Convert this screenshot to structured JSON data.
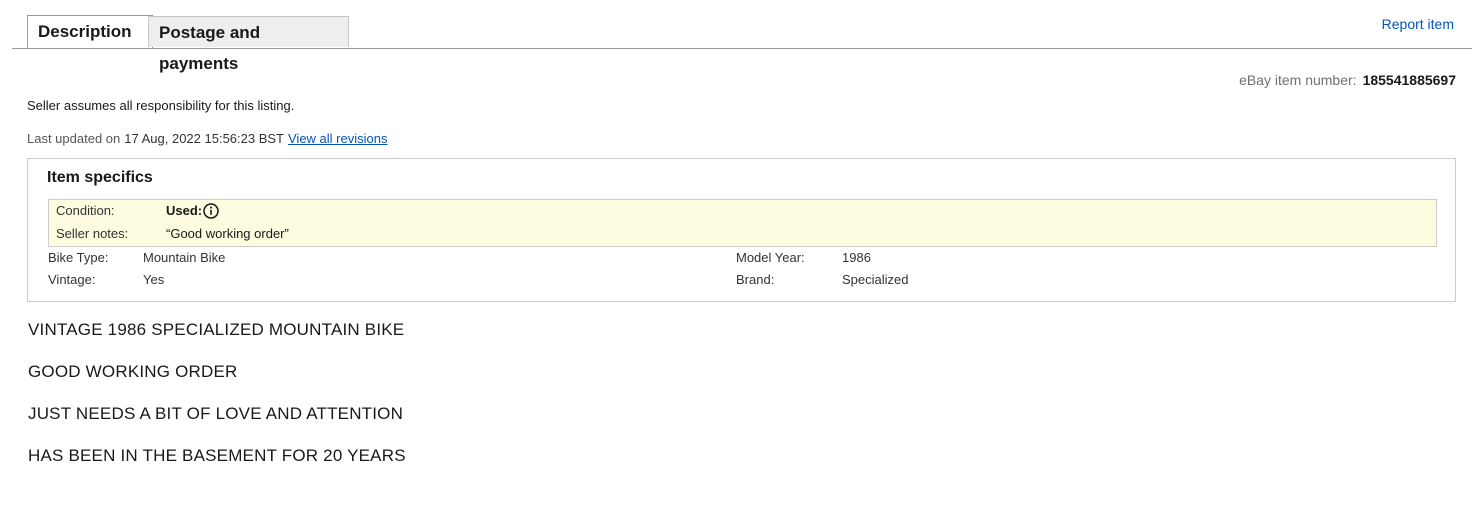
{
  "tabs": [
    {
      "label": "Description",
      "active": true
    },
    {
      "label": "Postage and payments",
      "active": false
    }
  ],
  "report_item": "Report item",
  "item_number": {
    "label": "eBay item number:",
    "value": "185541885697"
  },
  "seller_note": "Seller assumes all responsibility for this listing.",
  "last_updated": {
    "label": "Last updated on",
    "date": "17 Aug, 2022 15:56:23 BST",
    "link": "View all revisions"
  },
  "item_specifics": {
    "title": "Item specifics",
    "condition": {
      "label": "Condition:",
      "value": "Used:",
      "icon": "info-icon"
    },
    "seller_notes": {
      "label": "Seller notes:",
      "value": "“Good working order”"
    },
    "left": [
      {
        "label": "Bike Type:",
        "value": "Mountain Bike"
      },
      {
        "label": "Vintage:",
        "value": "Yes"
      }
    ],
    "right": [
      {
        "label": "Model Year:",
        "value": "1986"
      },
      {
        "label": "Brand:",
        "value": "Specialized"
      }
    ]
  },
  "description": [
    "VINTAGE 1986 SPECIALIZED MOUNTAIN BIKE",
    "GOOD WORKING ORDER",
    "JUST NEEDS A BIT OF LOVE AND ATTENTION",
    "HAS BEEN IN THE BASEMENT FOR 20 YEARS"
  ],
  "colors": {
    "link": "#0654ba",
    "condition_bg": "#fdfbe0",
    "tab_inactive_bg": "#eeeeee"
  }
}
